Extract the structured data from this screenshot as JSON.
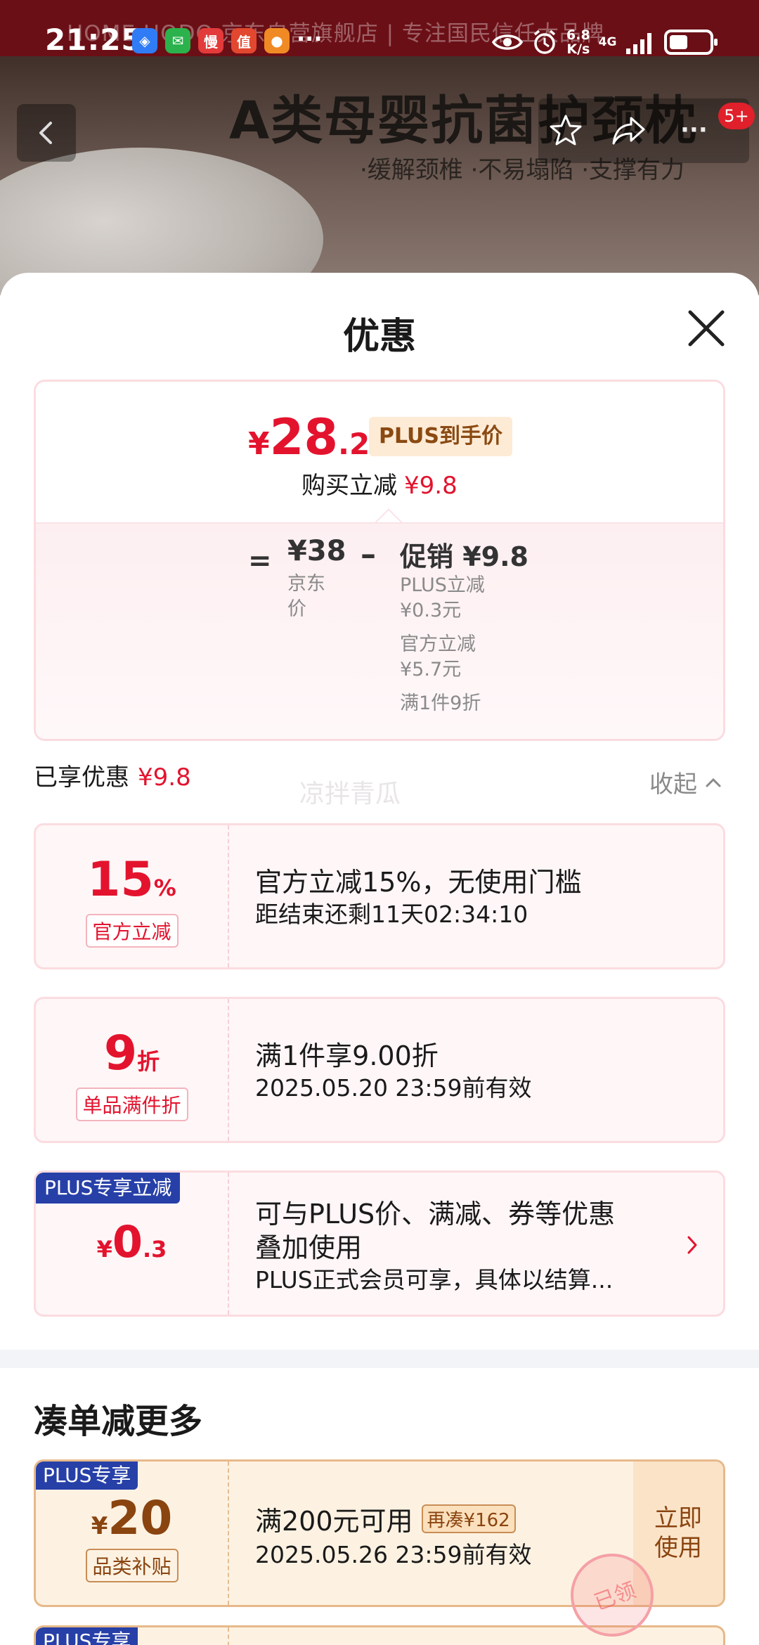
{
  "status_bar": {
    "time": "21:25",
    "app_icons": [
      {
        "name": "shield-app-icon",
        "glyph": "◈",
        "color": "#2f7cf6"
      },
      {
        "name": "wechat-icon",
        "glyph": "✉",
        "color": "#2bb24c"
      },
      {
        "name": "app-man-icon",
        "glyph": "慢",
        "color": "#e33b3b"
      },
      {
        "name": "app-zhi-icon",
        "glyph": "值",
        "color": "#e2472f"
      },
      {
        "name": "app-orange-icon",
        "glyph": "●",
        "color": "#f08a24"
      }
    ],
    "more_dots": "···",
    "net_speed_value": "6.8",
    "net_speed_unit": "K/s",
    "network_type": "4G",
    "battery_level": 0.45
  },
  "background_page": {
    "banner_text": "HOME HODO 京东自营旗舰店      |      专注国民信任大品牌",
    "product_title": "A类母婴抗菌护颈枕",
    "product_subtitle": "·缓解颈椎 ·不易塌陷 ·支撑有力",
    "notification_badge": "5+",
    "more_label": "···"
  },
  "sheet": {
    "title": "优惠",
    "summary": {
      "price_symbol": "¥",
      "price_integer": "28",
      "price_decimal": ".2",
      "price_tag": "PLUS到手价",
      "reduce_label": "购买立减",
      "reduce_value": "¥9.8",
      "equals": "=",
      "jd_price": "¥38",
      "jd_price_label": "京东价",
      "minus": "–",
      "promo_head": "促销 ¥9.8",
      "promo_items": [
        "PLUS立减",
        "¥0.3元",
        "官方立减",
        "¥5.7元",
        "满1件9折"
      ]
    },
    "enjoyed_label": "已享优惠",
    "enjoyed_value": "¥9.8",
    "watermark": "凉拌青瓜",
    "collapse_label": "收起",
    "coupons": [
      {
        "amount": "15",
        "unit": "%",
        "tag": "官方立减",
        "line1": "官方立减15%，无使用门槛",
        "line2": "距结束还剩11天02:34:10"
      },
      {
        "amount": "9",
        "unit": "折",
        "tag": "单品满件折",
        "line1": "满1件享9.00折",
        "line2": "2025.05.20 23:59前有效"
      },
      {
        "corner": "PLUS专享立减",
        "currency": "¥",
        "amount": "0",
        "decimal": ".3",
        "line1": "可与PLUS价、满减、券等优惠",
        "line1b": "叠加使用",
        "line2": "PLUS正式会员可享，具体以结算..."
      }
    ],
    "section_title": "凑单减更多",
    "gold_coupon": {
      "corner": "PLUS专享",
      "currency": "¥",
      "amount": "20",
      "tag": "品类补贴",
      "line1": "满200元可用",
      "more_tag": "再凑¥162",
      "line2": "2025.05.26 23:59前有效",
      "use_button": "立即使用",
      "stamp": "已领"
    },
    "gold_coupon_2_corner": "PLUS专享"
  }
}
